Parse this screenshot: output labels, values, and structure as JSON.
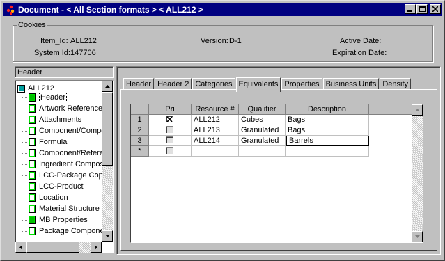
{
  "window": {
    "title": "Document - < All Section formats > < ALL212 >",
    "min_label": "_",
    "max_label": "□",
    "close_label": "✕"
  },
  "cookies": {
    "group_label": "Cookies",
    "item_id_label": "Item_Id:",
    "item_id_value": "ALL212",
    "system_id_label": "System Id:",
    "system_id_value": "147706",
    "version_label": "Version:",
    "version_value": "D-1",
    "active_date_label": "Active Date:",
    "expiration_date_label": "Expiration Date:"
  },
  "left_panel": {
    "header_label": "Header",
    "tree_root": "ALL212",
    "tree_items": [
      "Header",
      "Artwork Reference",
      "Attachments",
      "Component/Compor",
      "Formula",
      "Component/Referer",
      "Ingredient Compositi",
      "LCC-Package Copy",
      "LCC-Product",
      "Location",
      "Material Structure",
      "MB Properties",
      "Package Componer"
    ]
  },
  "tabs": [
    "Header",
    "Header 2",
    "Categories",
    "Equivalents",
    "Properties",
    "Business Units",
    "Density"
  ],
  "active_tab": "Equivalents",
  "grid": {
    "columns": [
      "Pri",
      "Resource #",
      "Qualifier",
      "Description"
    ],
    "row_numbers": [
      "1",
      "2",
      "3",
      "*"
    ],
    "rows": [
      {
        "pri": true,
        "resource": "ALL212",
        "qualifier": "Cubes",
        "description": "Bags"
      },
      {
        "pri": false,
        "resource": "ALL213",
        "qualifier": "Granulated",
        "description": "Bags"
      },
      {
        "pri": false,
        "resource": "ALL214",
        "qualifier": "Granulated",
        "description": "Barrels"
      }
    ]
  },
  "colors": {
    "titlebar": "#000080",
    "face": "#c0c0c0",
    "doc_icon_green": "#00c000"
  }
}
